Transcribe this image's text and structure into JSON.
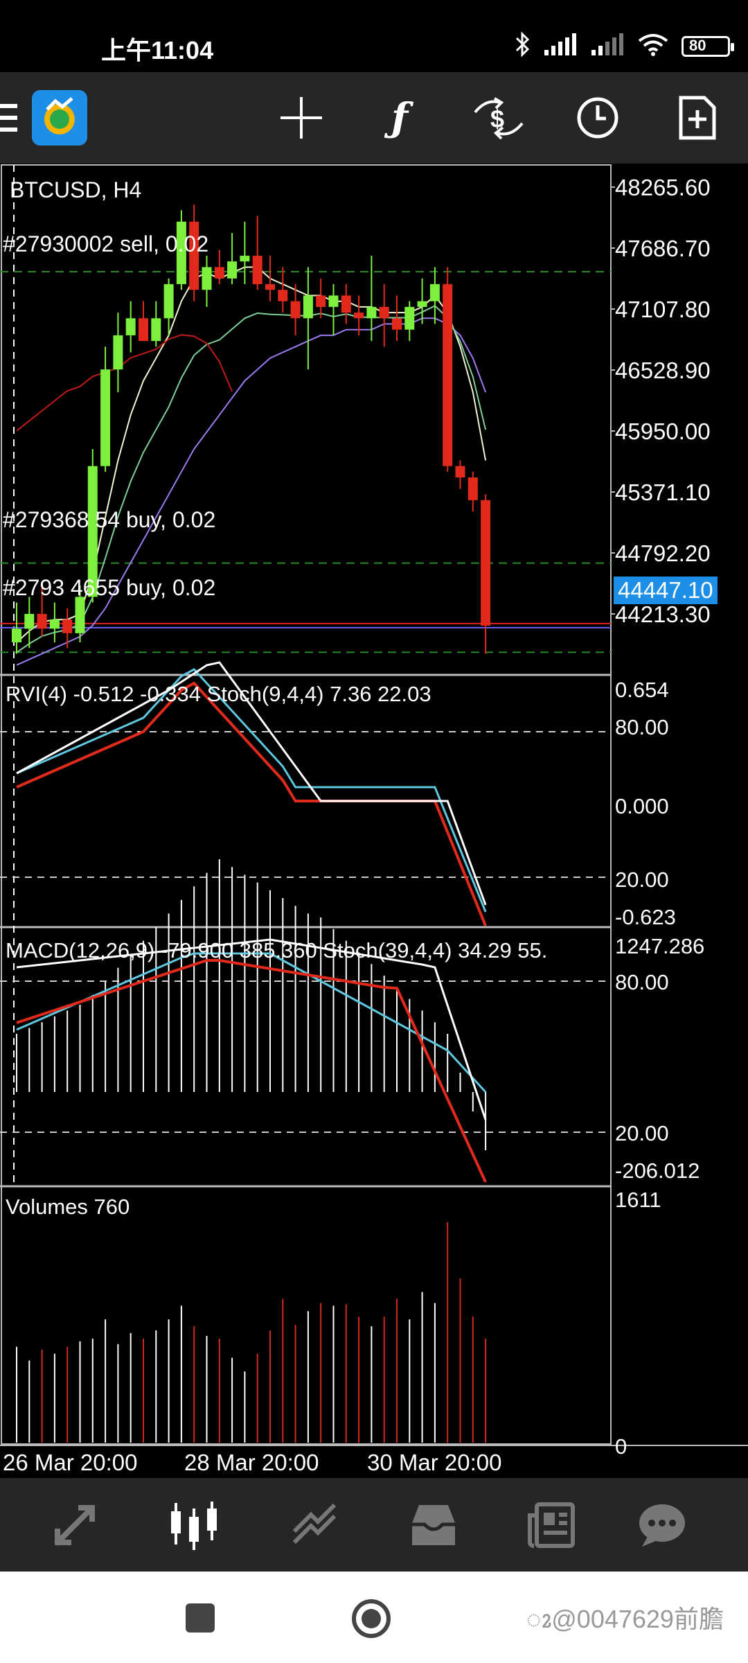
{
  "status_bar": {
    "time": "上午11:04",
    "battery": "80"
  },
  "toolbar": {
    "icons": [
      "menu-icon",
      "metatrader-logo",
      "crosshair-icon",
      "indicators-icon",
      "symbol-change-icon",
      "timeframe-icon",
      "new-order-icon"
    ]
  },
  "chart": {
    "symbol": "BTCUSD, H4",
    "orders": [
      {
        "label": "#27930002 sell, 0.02",
        "price": 47559.4
      },
      {
        "label": "#279368 54 buy, 0.02",
        "price": 44996.7
      },
      {
        "label": "#2793 4655 buy, 0.02",
        "price": 44212.0
      }
    ],
    "price_scale": [
      "48265.60",
      "47686.70",
      "47107.80",
      "46528.90",
      "45950.00",
      "45371.10",
      "44792.20",
      "44213.30"
    ],
    "current_price": "44447.10",
    "price_range": [
      44050,
      48450
    ]
  },
  "rvi_panel": {
    "label": "RVI(4) -0.512 -0.334 Stoch(9,4,4) 7.36 22.03",
    "scale": [
      "0.654",
      "80.00",
      "0.000",
      "20.00",
      "-0.623"
    ]
  },
  "macd_panel": {
    "label": "MACD(12,26,9) -79.900 385.360 Stoch(39,4,4) 34.29 55.",
    "scale": [
      "1247.286",
      "80.00",
      "20.00",
      "-206.012"
    ]
  },
  "volume_panel": {
    "label": "Volumes 760",
    "scale": [
      "1611",
      "0"
    ]
  },
  "time_axis": [
    "26 Mar 20:00",
    "28 Mar 20:00",
    "30 Mar 20:00"
  ],
  "chart_data": {
    "type": "candlestick",
    "title": "BTCUSD, H4",
    "candles": [
      {
        "o": 44300,
        "h": 44650,
        "l": 44200,
        "c": 44420
      },
      {
        "o": 44420,
        "h": 44700,
        "l": 44250,
        "c": 44550
      },
      {
        "o": 44550,
        "h": 44800,
        "l": 44350,
        "c": 44420
      },
      {
        "o": 44420,
        "h": 44650,
        "l": 44300,
        "c": 44500
      },
      {
        "o": 44500,
        "h": 44600,
        "l": 44250,
        "c": 44380
      },
      {
        "o": 44380,
        "h": 44800,
        "l": 44300,
        "c": 44700
      },
      {
        "o": 44700,
        "h": 46000,
        "l": 44650,
        "c": 45850
      },
      {
        "o": 45850,
        "h": 46900,
        "l": 45800,
        "c": 46700
      },
      {
        "o": 46700,
        "h": 47200,
        "l": 46500,
        "c": 47000
      },
      {
        "o": 47000,
        "h": 47300,
        "l": 46850,
        "c": 47150
      },
      {
        "o": 47150,
        "h": 47300,
        "l": 47000,
        "c": 46950
      },
      {
        "o": 46950,
        "h": 47300,
        "l": 46900,
        "c": 47150
      },
      {
        "o": 47150,
        "h": 47500,
        "l": 47000,
        "c": 47450
      },
      {
        "o": 47450,
        "h": 48100,
        "l": 47400,
        "c": 48000
      },
      {
        "o": 48000,
        "h": 48150,
        "l": 47300,
        "c": 47400
      },
      {
        "o": 47400,
        "h": 47700,
        "l": 47250,
        "c": 47600
      },
      {
        "o": 47600,
        "h": 47750,
        "l": 47450,
        "c": 47500
      },
      {
        "o": 47500,
        "h": 47900,
        "l": 47450,
        "c": 47650
      },
      {
        "o": 47650,
        "h": 48000,
        "l": 47450,
        "c": 47700
      },
      {
        "o": 47700,
        "h": 48050,
        "l": 47400,
        "c": 47450
      },
      {
        "o": 47450,
        "h": 47700,
        "l": 47300,
        "c": 47400
      },
      {
        "o": 47400,
        "h": 47600,
        "l": 47200,
        "c": 47300
      },
      {
        "o": 47300,
        "h": 47450,
        "l": 47000,
        "c": 47150
      },
      {
        "o": 47150,
        "h": 47600,
        "l": 46700,
        "c": 47350
      },
      {
        "o": 47350,
        "h": 47500,
        "l": 47150,
        "c": 47250
      },
      {
        "o": 47250,
        "h": 47450,
        "l": 47000,
        "c": 47350
      },
      {
        "o": 47350,
        "h": 47450,
        "l": 47100,
        "c": 47200
      },
      {
        "o": 47200,
        "h": 47350,
        "l": 47000,
        "c": 47150
      },
      {
        "o": 47150,
        "h": 47700,
        "l": 46950,
        "c": 47250
      },
      {
        "o": 47250,
        "h": 47450,
        "l": 46900,
        "c": 47150
      },
      {
        "o": 47150,
        "h": 47350,
        "l": 46950,
        "c": 47050
      },
      {
        "o": 47050,
        "h": 47300,
        "l": 46950,
        "c": 47250
      },
      {
        "o": 47250,
        "h": 47500,
        "l": 47100,
        "c": 47300
      },
      {
        "o": 47300,
        "h": 47600,
        "l": 47100,
        "c": 47450
      },
      {
        "o": 47450,
        "h": 47600,
        "l": 45800,
        "c": 45850
      },
      {
        "o": 45850,
        "h": 45900,
        "l": 45650,
        "c": 45750
      },
      {
        "o": 45750,
        "h": 45800,
        "l": 45450,
        "c": 45550
      },
      {
        "o": 45550,
        "h": 45600,
        "l": 44200,
        "c": 44447
      }
    ],
    "volumes": [
      700,
      600,
      680,
      650,
      700,
      740,
      760,
      900,
      720,
      800,
      760,
      820,
      900,
      1000,
      850,
      780,
      760,
      620,
      520,
      650,
      820,
      1050,
      860,
      960,
      1020,
      1000,
      1010,
      920,
      850,
      920,
      1050,
      900,
      1100,
      1020,
      1611,
      1200,
      920,
      760
    ],
    "ma_fast": [
      44300,
      44400,
      44480,
      44500,
      44500,
      44550,
      44900,
      45400,
      45900,
      46300,
      46600,
      46800,
      47000,
      47300,
      47500,
      47550,
      47500,
      47550,
      47600,
      47600,
      47500,
      47450,
      47400,
      47350,
      47350,
      47300,
      47300,
      47250,
      47250,
      47200,
      47200,
      47200,
      47250,
      47350,
      47200,
      46900,
      46500,
      45900
    ],
    "ma_slow": [
      44100,
      44150,
      44200,
      44250,
      44300,
      44350,
      44450,
      44600,
      44800,
      45000,
      45200,
      45400,
      45600,
      45800,
      46000,
      46150,
      46300,
      46450,
      46600,
      46700,
      46800,
      46850,
      46900,
      46950,
      47000,
      47000,
      47050,
      47050,
      47050,
      47100,
      47100,
      47100,
      47150,
      47150,
      47100,
      47000,
      46800,
      46500
    ]
  }
}
